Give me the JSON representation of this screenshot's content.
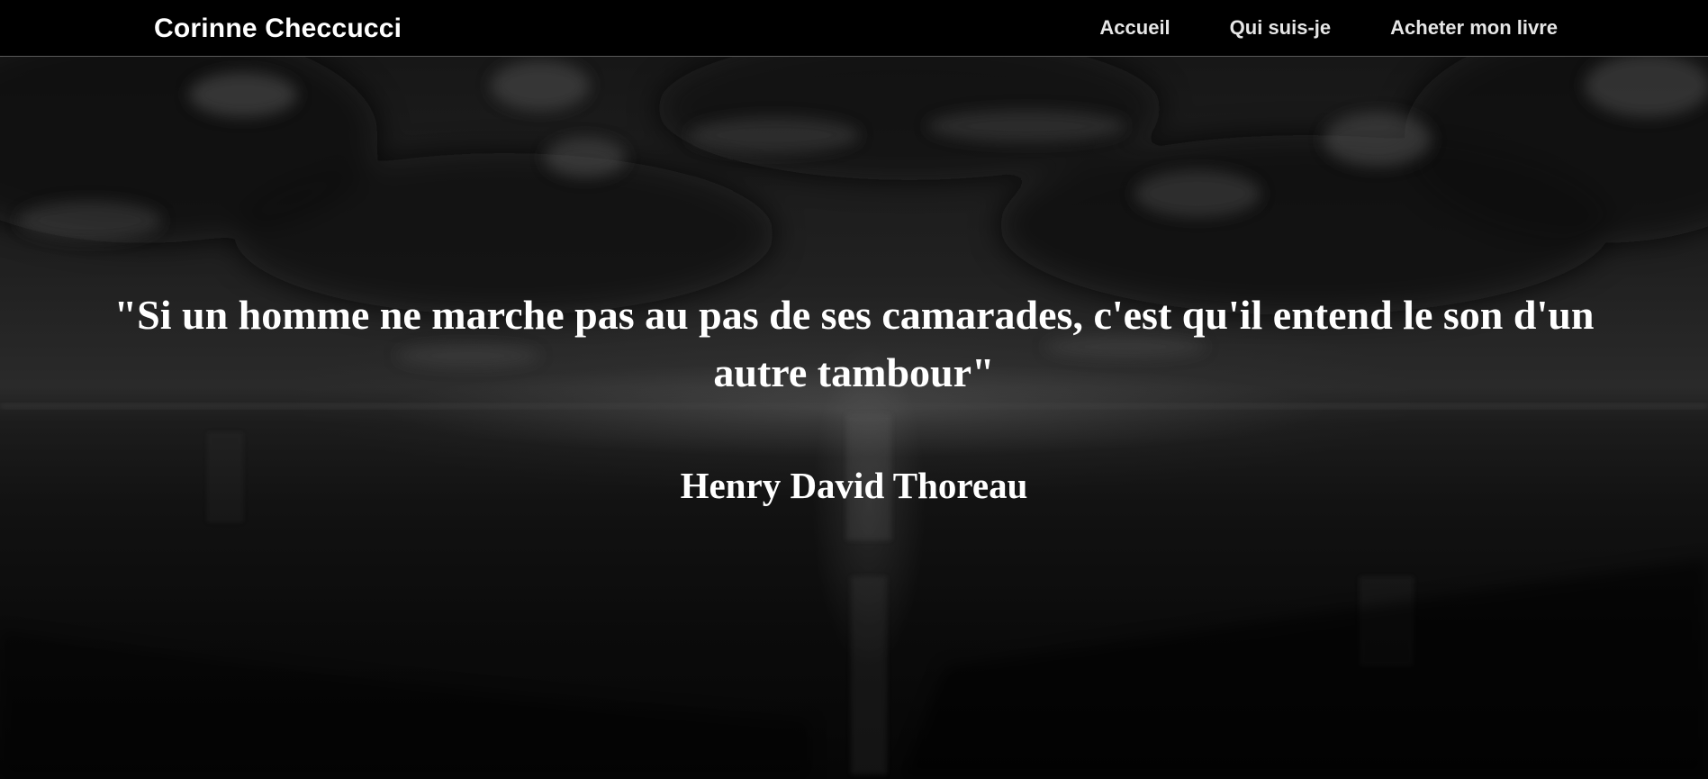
{
  "header": {
    "brand": "Corinne Checcucci",
    "nav": [
      {
        "label": "Accueil"
      },
      {
        "label": "Qui suis-je"
      },
      {
        "label": "Acheter mon livre"
      }
    ]
  },
  "hero": {
    "quote": "\"Si un homme ne marche pas au pas de ses camarades, c'est qu'il entend le son d'un autre tambour\"",
    "author": "Henry David Thoreau"
  },
  "colors": {
    "navbar_bg": "#000000",
    "text": "#ffffff",
    "nav_text": "#e6e6e6"
  }
}
